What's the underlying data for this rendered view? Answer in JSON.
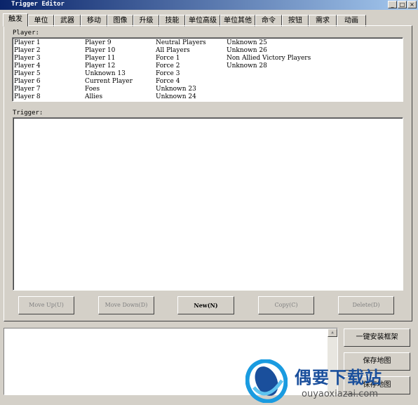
{
  "window": {
    "title": "Trigger Editor"
  },
  "tabs": [
    "触发",
    "单位",
    "武器",
    "移动",
    "图像",
    "升级",
    "技能",
    "单位高级",
    "单位其他",
    "命令",
    "按钮",
    "需求",
    "动画"
  ],
  "player_section": {
    "label": "Player:",
    "columns": [
      [
        "Player 1",
        "Player 2",
        "Player 3",
        "Player 4",
        "Player 5",
        "Player 6",
        "Player 7",
        "Player 8"
      ],
      [
        "Player 9",
        "Player 10",
        "Player 11",
        "Player 12",
        "Unknown 13",
        "Current Player",
        "Foes",
        "Allies"
      ],
      [
        "Neutral Players",
        "All Players",
        "Force 1",
        "Force 2",
        "Force 3",
        "Force 4",
        "Unknown 23",
        "Unknown 24"
      ],
      [
        "Unknown 25",
        "Unknown 26",
        "Non Allied Victory Players",
        "Unknown 28"
      ]
    ]
  },
  "trigger_section": {
    "label": "Trigger:"
  },
  "buttons": {
    "move_up": "Move Up(U)",
    "move_down": "Move Down(D)",
    "new": "New(N)",
    "copy": "Copy(C)",
    "delete": "Delete(D)"
  },
  "side_buttons": {
    "install": "一键安装框架",
    "save_map": "保存地图",
    "third": "保存地图"
  },
  "watermark": {
    "brand": "偶要下载站",
    "url": "ouyaoxiazai.com"
  }
}
